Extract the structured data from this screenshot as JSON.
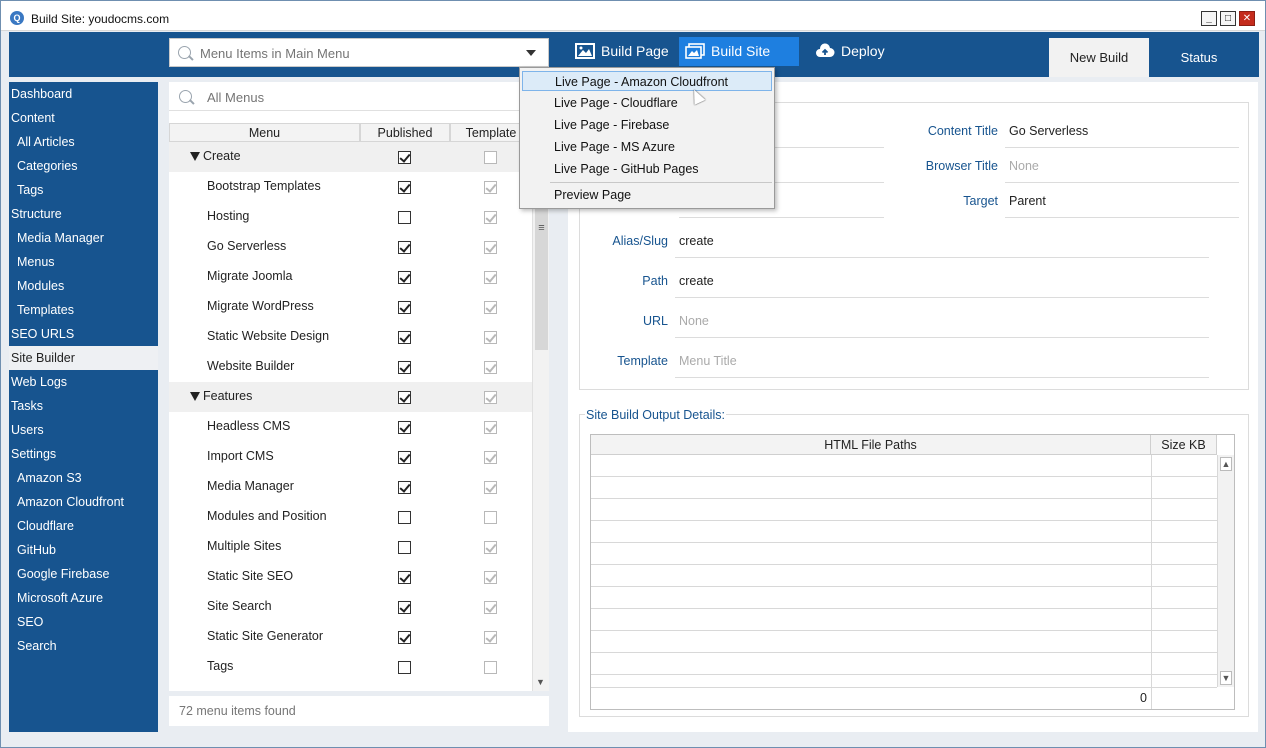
{
  "window": {
    "title": "Build Site: youdocms.com"
  },
  "header": {
    "menu_combo_placeholder": "Menu Items in Main Menu",
    "build_page_label": "Build Page",
    "build_site_label": "Build Site",
    "deploy_label": "Deploy",
    "tab_new_build": "New Build",
    "tab_status": "Status"
  },
  "sidebar": {
    "items": [
      {
        "label": "Dashboard",
        "sub": false
      },
      {
        "label": "Content",
        "sub": false
      },
      {
        "label": "All Articles",
        "sub": true
      },
      {
        "label": "Categories",
        "sub": true
      },
      {
        "label": "Tags",
        "sub": true
      },
      {
        "label": "Structure",
        "sub": false
      },
      {
        "label": "Media Manager",
        "sub": true
      },
      {
        "label": "Menus",
        "sub": true
      },
      {
        "label": "Modules",
        "sub": true
      },
      {
        "label": "Templates",
        "sub": true
      },
      {
        "label": "SEO URLS",
        "sub": false
      },
      {
        "label": "Site Builder",
        "sub": false,
        "active": true
      },
      {
        "label": "Web Logs",
        "sub": false
      },
      {
        "label": "Tasks",
        "sub": false
      },
      {
        "label": "Users",
        "sub": false
      },
      {
        "label": "Settings",
        "sub": false
      },
      {
        "label": "Amazon S3",
        "sub": true
      },
      {
        "label": "Amazon Cloudfront",
        "sub": true
      },
      {
        "label": "Cloudflare",
        "sub": true
      },
      {
        "label": "GitHub",
        "sub": true
      },
      {
        "label": "Google Firebase",
        "sub": true
      },
      {
        "label": "Microsoft Azure",
        "sub": true
      },
      {
        "label": "SEO",
        "sub": true
      },
      {
        "label": "Search",
        "sub": true
      }
    ]
  },
  "menu_list": {
    "search_placeholder": "All Menus",
    "col_menu": "Menu",
    "col_published": "Published",
    "col_template": "Template",
    "rows": [
      {
        "label": "Create",
        "group": true,
        "published": true,
        "template": false
      },
      {
        "label": "Bootstrap Templates",
        "group": false,
        "published": true,
        "template": true
      },
      {
        "label": "Hosting",
        "group": false,
        "published": false,
        "template": true
      },
      {
        "label": "Go Serverless",
        "group": false,
        "published": true,
        "template": true
      },
      {
        "label": "Migrate Joomla",
        "group": false,
        "published": true,
        "template": true
      },
      {
        "label": "Migrate WordPress",
        "group": false,
        "published": true,
        "template": true
      },
      {
        "label": "Static Website Design",
        "group": false,
        "published": true,
        "template": true
      },
      {
        "label": "Website Builder",
        "group": false,
        "published": true,
        "template": true
      },
      {
        "label": "Features",
        "group": true,
        "published": true,
        "template": true
      },
      {
        "label": "Headless CMS",
        "group": false,
        "published": true,
        "template": true
      },
      {
        "label": "Import CMS",
        "group": false,
        "published": true,
        "template": true
      },
      {
        "label": "Media Manager",
        "group": false,
        "published": true,
        "template": true
      },
      {
        "label": "Modules and Position",
        "group": false,
        "published": false,
        "template": false
      },
      {
        "label": "Multiple Sites",
        "group": false,
        "published": false,
        "template": true
      },
      {
        "label": "Static Site SEO",
        "group": false,
        "published": true,
        "template": true
      },
      {
        "label": "Site Search",
        "group": false,
        "published": true,
        "template": true
      },
      {
        "label": "Static Site Generator",
        "group": false,
        "published": true,
        "template": true
      },
      {
        "label": "Tags",
        "group": false,
        "published": false,
        "template": false
      }
    ],
    "footer_count": "72 menu items found"
  },
  "form": {
    "content_title_label": "Content Title",
    "content_title_value": "Go Serverless",
    "browser_title_label": "Browser Title",
    "browser_title_value": "None",
    "target_label": "Target",
    "target_value": "Parent",
    "alias_label": "Alias/Slug",
    "alias_value": "create",
    "path_label": "Path",
    "path_value": "create",
    "url_label": "URL",
    "url_value": "None",
    "template_label": "Template",
    "template_value": "Menu Title"
  },
  "output": {
    "title": "Site Build Output Details:",
    "col_paths": "HTML File Paths",
    "col_size": "Size KB",
    "total": "0"
  },
  "dropdown": {
    "items": [
      "Live Page - Amazon Cloudfront",
      "Live Page - Cloudflare",
      "Live Page - Firebase",
      "Live Page - MS Azure",
      "Live Page - GitHub Pages"
    ],
    "preview_label": "Preview Page"
  }
}
